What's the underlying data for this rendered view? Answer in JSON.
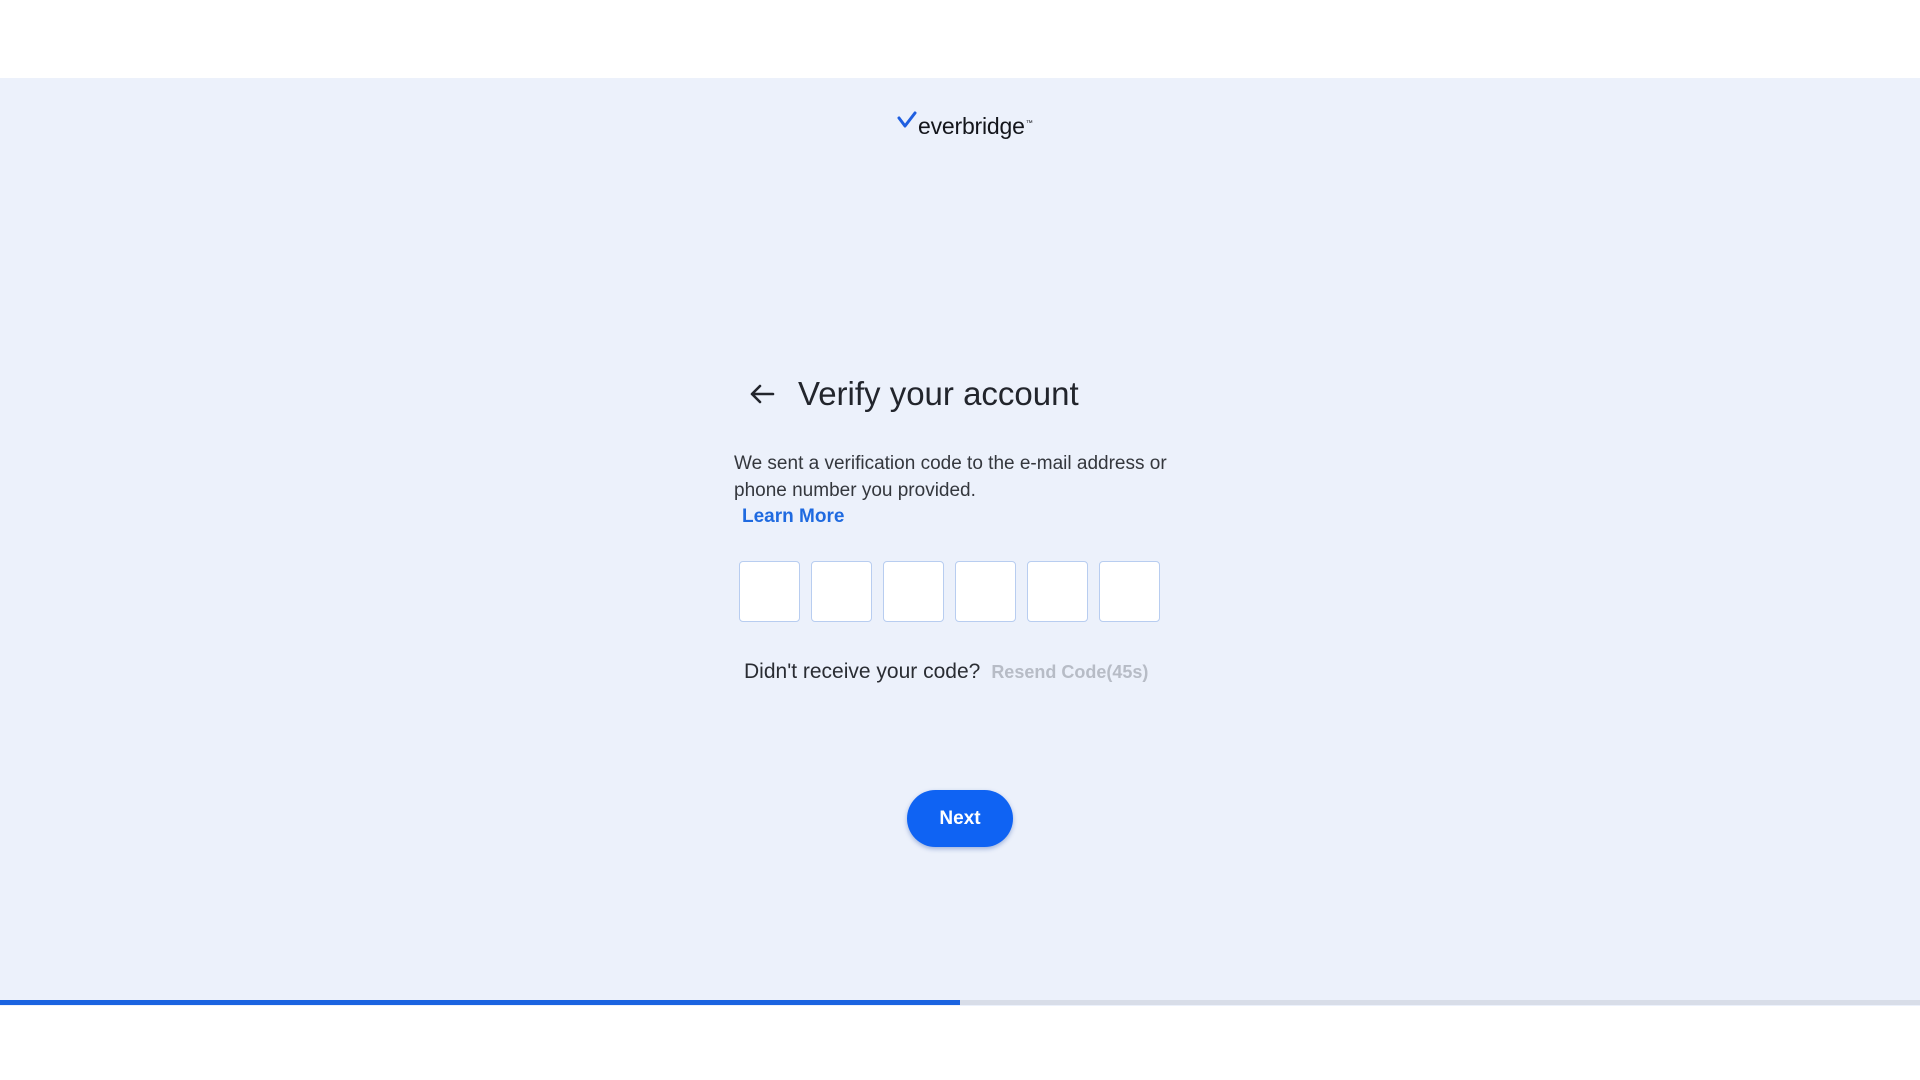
{
  "brand": {
    "logo_text": "everbridge",
    "trademark": "™",
    "mark_color": "#1f5fe0"
  },
  "verify": {
    "back_icon": "arrow-left-icon",
    "title": "Verify your account",
    "description": "We sent a verification code to the e-mail address or phone number you provided.",
    "learn_more": "Learn More",
    "code_boxes": [
      "",
      "",
      "",
      "",
      "",
      ""
    ],
    "resend_question": "Didn't receive your code?",
    "resend_link": "Resend Code(45s)",
    "next_label": "Next"
  },
  "progress": {
    "value": 0.5,
    "fill_color": "#1a63e0",
    "track_color": "#d8dde8"
  },
  "colors": {
    "accent": "#0f63f3",
    "link": "#1f6ae0",
    "disabled_text": "#b7bcc6",
    "background": "#ecf1fb"
  }
}
